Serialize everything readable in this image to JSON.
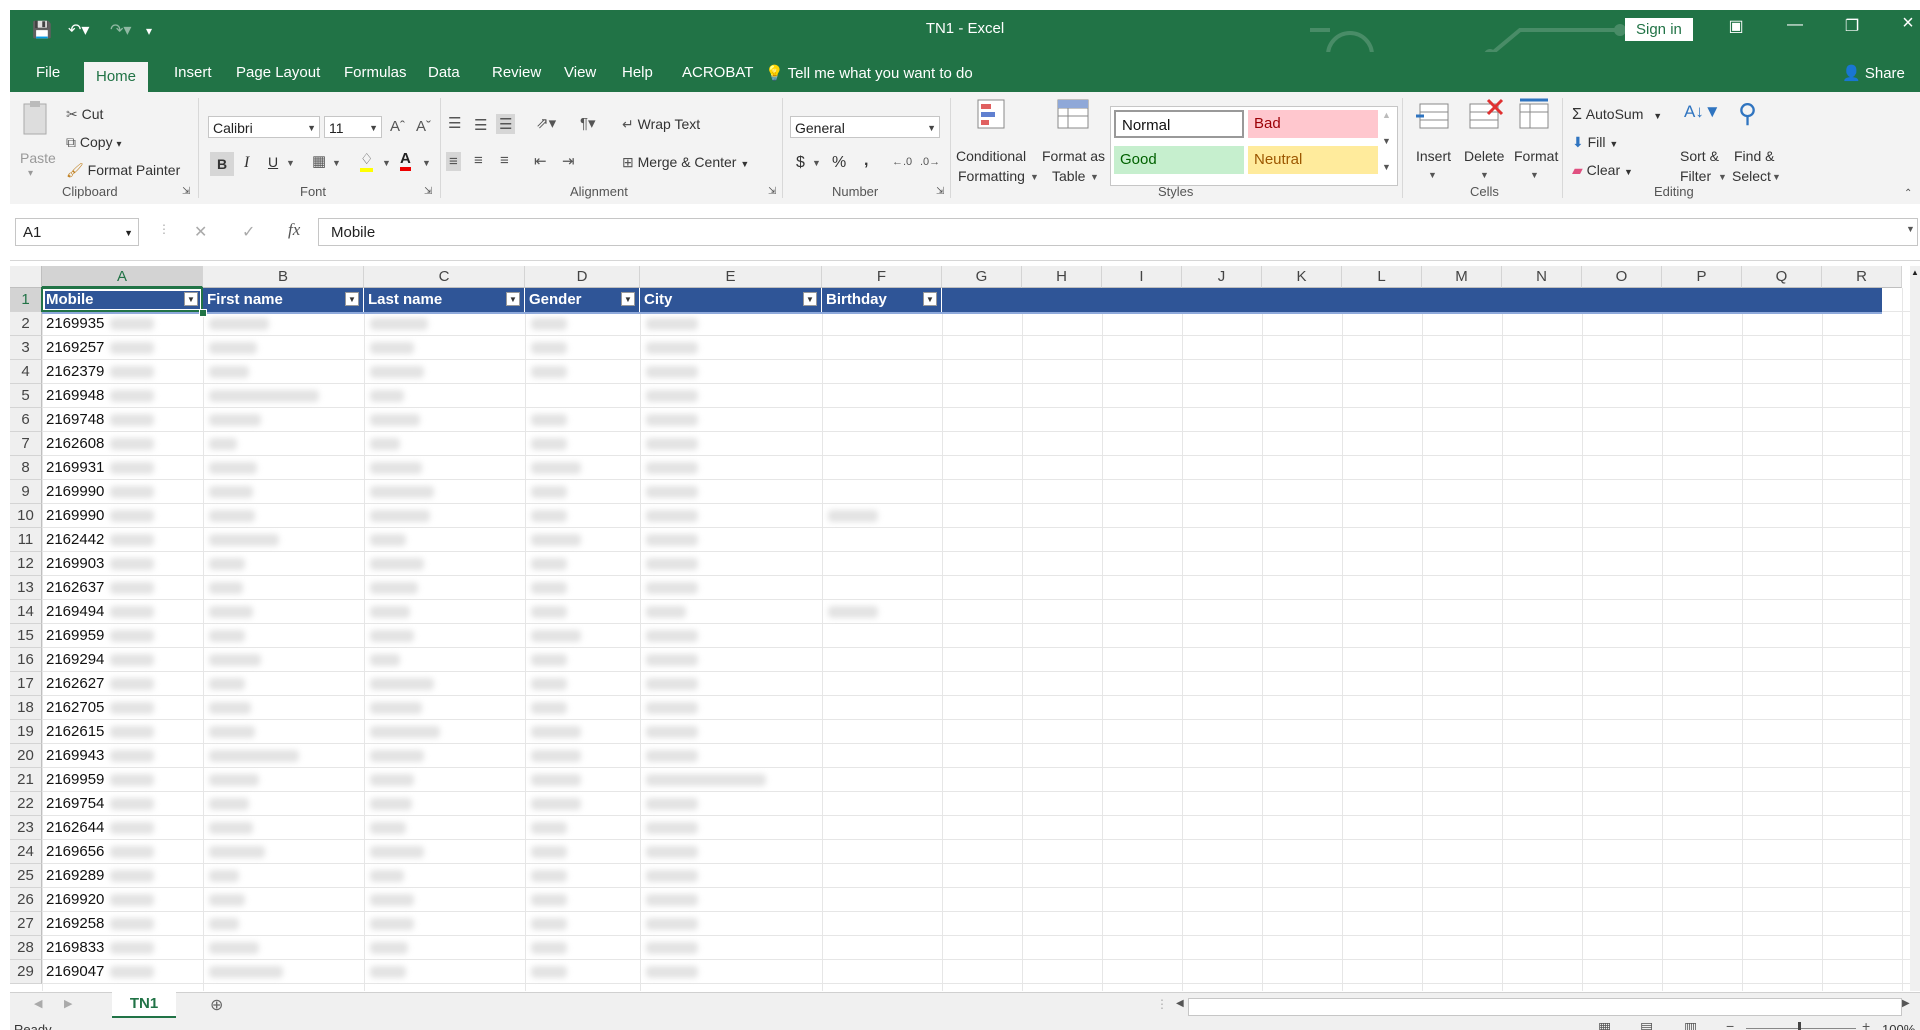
{
  "window": {
    "title": "TN1  -  Excel",
    "sign_in": "Sign in"
  },
  "menu": {
    "tabs": [
      "File",
      "Home",
      "Insert",
      "Page Layout",
      "Formulas",
      "Data",
      "Review",
      "View",
      "Help",
      "ACROBAT"
    ],
    "active": "Home",
    "tell_me": "Tell me what you want to do",
    "share": "Share"
  },
  "ribbon": {
    "clipboard": {
      "label": "Clipboard",
      "paste": "Paste",
      "cut": "Cut",
      "copy": "Copy",
      "format_painter": "Format Painter"
    },
    "font": {
      "label": "Font",
      "name": "Calibri",
      "size": "11",
      "bold": "B",
      "italic": "I",
      "underline": "U"
    },
    "alignment": {
      "label": "Alignment",
      "wrap_text": "Wrap Text",
      "merge_center": "Merge & Center"
    },
    "number": {
      "label": "Number",
      "format": "General",
      "currency": "$",
      "percent": "%",
      "comma": ","
    },
    "styles": {
      "label": "Styles",
      "conditional_formatting_1": "Conditional",
      "conditional_formatting_2": "Formatting",
      "format_as_table_1": "Format as",
      "format_as_table_2": "Table",
      "normal": "Normal",
      "bad": "Bad",
      "good": "Good",
      "neutral": "Neutral"
    },
    "cells": {
      "label": "Cells",
      "insert": "Insert",
      "delete": "Delete",
      "format": "Format"
    },
    "editing": {
      "label": "Editing",
      "autosum": "AutoSum",
      "fill": "Fill",
      "clear": "Clear",
      "sort_filter_1": "Sort &",
      "sort_filter_2": "Filter",
      "find_select_1": "Find &",
      "find_select_2": "Select"
    }
  },
  "formula_bar": {
    "name_box": "A1",
    "content": "Mobile"
  },
  "grid": {
    "column_letters": [
      "A",
      "B",
      "C",
      "D",
      "E",
      "F",
      "G",
      "H",
      "I",
      "J",
      "K",
      "L",
      "M",
      "N",
      "O",
      "P",
      "Q",
      "R"
    ],
    "selected_column": "A",
    "headers": [
      "Mobile",
      "First name",
      "Last name",
      "Gender",
      "City",
      "Birthday"
    ],
    "row_numbers": [
      "1",
      "2",
      "3",
      "4",
      "5",
      "6",
      "7",
      "8",
      "9",
      "10",
      "11",
      "12",
      "13",
      "14",
      "15",
      "16",
      "17",
      "18",
      "19",
      "20",
      "21",
      "22",
      "23",
      "24",
      "25",
      "26",
      "27",
      "28",
      "29"
    ],
    "mobiles": [
      "2169935",
      "2169257",
      "2162379",
      "2169948",
      "2169748",
      "2162608",
      "2169931",
      "2169990",
      "2169990",
      "2162442",
      "2169903",
      "2162637",
      "2169494",
      "2169959",
      "2169294",
      "2162627",
      "2162705",
      "2162615",
      "2169943",
      "2169959",
      "2169754",
      "2162644",
      "2169656",
      "2169289",
      "2169920",
      "2169258",
      "2169833",
      "2169047"
    ]
  },
  "sheets": {
    "tabs": [
      "TN1"
    ],
    "active": "TN1"
  },
  "status": {
    "ready": "Ready",
    "zoom": "100%"
  },
  "colors": {
    "excel_green": "#217346",
    "table_header_blue": "#2f5597",
    "bad_fill": "#ffc7ce",
    "good_fill": "#c6efce",
    "neutral_fill": "#ffeb9c"
  }
}
